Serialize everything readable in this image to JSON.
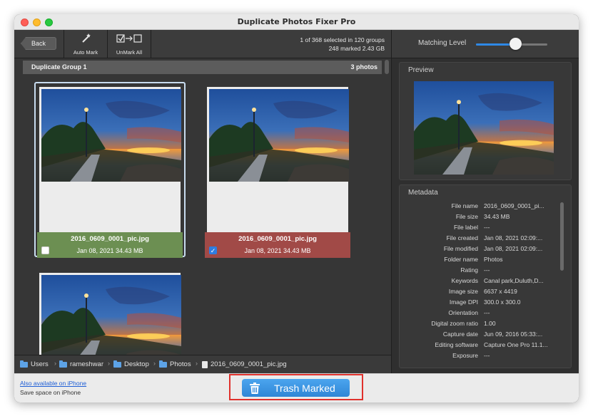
{
  "window": {
    "title": "Duplicate Photos Fixer Pro"
  },
  "toolbar": {
    "back_label": "Back",
    "auto_mark_label": "Auto Mark",
    "unmark_all_label": "UnMark All",
    "status_line1": "1 of 368 selected in 120 groups",
    "status_line2": "248 marked 2.43 GB"
  },
  "matching": {
    "label": "Matching Level",
    "level": 0.55
  },
  "group": {
    "name": "Duplicate Group 1",
    "count": "3 photos",
    "photos": [
      {
        "filename": "2016_0609_0001_pic.jpg",
        "meta": "Jan 08, 2021  34.43 MB",
        "checked": false,
        "status": "kept"
      },
      {
        "filename": "2016_0609_0001_pic.jpg",
        "meta": "Jan 08, 2021  34.43 MB",
        "checked": true,
        "status": "marked"
      },
      {
        "filename": "",
        "meta": "",
        "checked": false,
        "status": ""
      }
    ]
  },
  "path": {
    "items": [
      "Users",
      "rameshwar",
      "Desktop",
      "Photos",
      "2016_0609_0001_pic.jpg"
    ],
    "separator": "›"
  },
  "preview": {
    "title": "Preview"
  },
  "metadata": {
    "title": "Metadata",
    "rows": [
      {
        "key": "File name",
        "value": "2016_0609_0001_pi..."
      },
      {
        "key": "File size",
        "value": "34.43 MB"
      },
      {
        "key": "File label",
        "value": "---"
      },
      {
        "key": "File created",
        "value": "Jan 08, 2021 02:09:..."
      },
      {
        "key": "File modified",
        "value": "Jan 08, 2021 02:09:..."
      },
      {
        "key": "Folder name",
        "value": "Photos"
      },
      {
        "key": "Rating",
        "value": "---"
      },
      {
        "key": "Keywords",
        "value": "Canal park,Duluth,D..."
      },
      {
        "key": "Image size",
        "value": "6637 x 4419"
      },
      {
        "key": "Image DPI",
        "value": "300.0 x 300.0"
      },
      {
        "key": "Orientation",
        "value": "---"
      },
      {
        "key": "Digital zoom ratio",
        "value": "1.00"
      },
      {
        "key": "Capture date",
        "value": "Jun 09, 2016 05:33:..."
      },
      {
        "key": "Editing software",
        "value": "Capture One Pro 11.1..."
      },
      {
        "key": "Exposure",
        "value": "---"
      }
    ]
  },
  "footer": {
    "link": "Also available on iPhone",
    "sub": "Save space on iPhone",
    "trash_label": "Trash Marked"
  },
  "colors": {
    "kept": "#6c8f52",
    "marked": "#a14a47",
    "accent": "#2f86d6",
    "highlight": "#e0312c"
  }
}
